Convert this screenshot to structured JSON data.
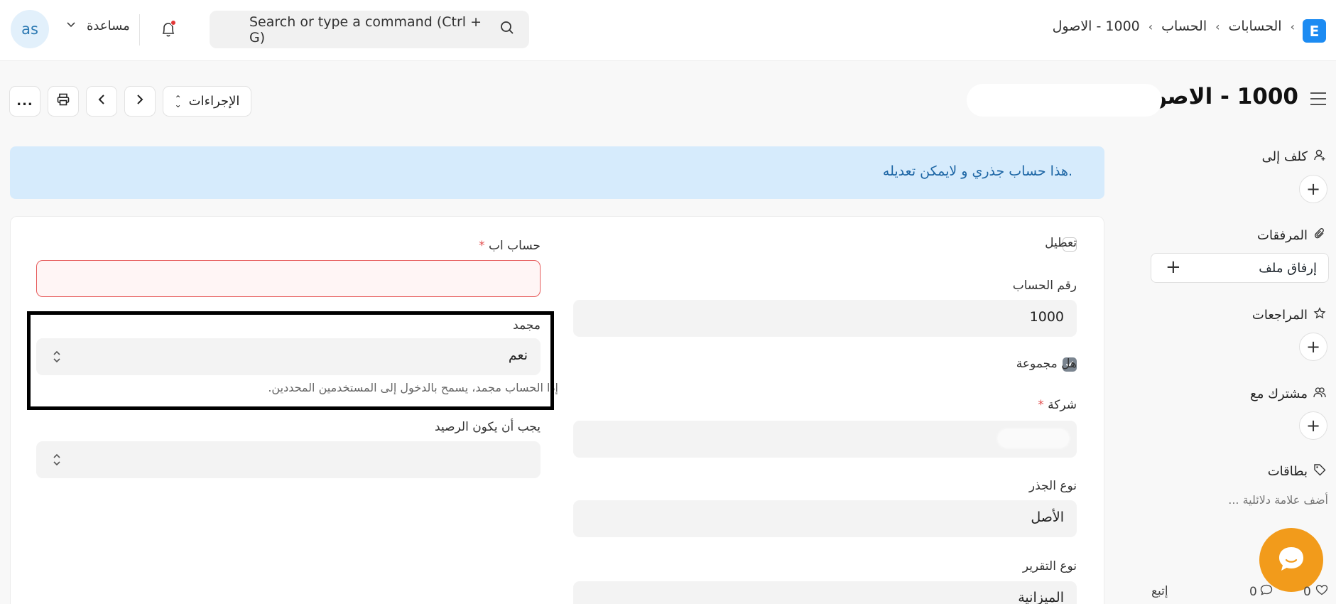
{
  "navbar": {
    "avatar_initials": "as",
    "help_label": "مساعدة",
    "search_placeholder": "Search or type a command (Ctrl + G)",
    "breadcrumbs": [
      "الحسابات",
      "الحساب",
      "1000 - الاصول"
    ],
    "logo_letter": "E"
  },
  "page": {
    "title": "1000 - الاصول",
    "actions_label": "الإجراءات",
    "more_label": "..."
  },
  "alert": {
    "text": ".هذا حساب جذري و لايمكن تعديله"
  },
  "form": {
    "disable_label": "تعطيل",
    "account_number_label": "رقم الحساب",
    "account_number_value": "1000",
    "is_group_label": "هل مجموعة",
    "company_label": "شركة",
    "root_type_label": "نوع الجذر",
    "root_type_value": "الأصل",
    "report_type_label": "نوع التقرير",
    "report_type_value": "الميزانية",
    "parent_account_label": "حساب اب",
    "frozen_label": "مجمد",
    "frozen_value": "نعم",
    "frozen_help": "إذا الحساب مجمد، يسمح بالدخول إلى المستخدمين المحددين.",
    "balance_must_be_label": "يجب أن يكون الرصيد",
    "required_mark": "*"
  },
  "sidebar": {
    "assign_to_label": "كلف إلى",
    "attachments_label": "المرفقات",
    "attach_file_label": "إرفاق ملف",
    "reviews_label": "المراجعات",
    "shared_with_label": "مشترك مع",
    "tags_label": "بطاقات",
    "tag_placeholder": "أضف علامة دلائلية ...",
    "follow_label": "إتبع",
    "comment_count": "0",
    "like_count": "0"
  },
  "colors": {
    "accent": "#1c8bf2",
    "alert_bg": "#d6ebfc",
    "alert_text": "#1d66a5",
    "chat": "#f29b1b",
    "error": "#e65a5a"
  }
}
